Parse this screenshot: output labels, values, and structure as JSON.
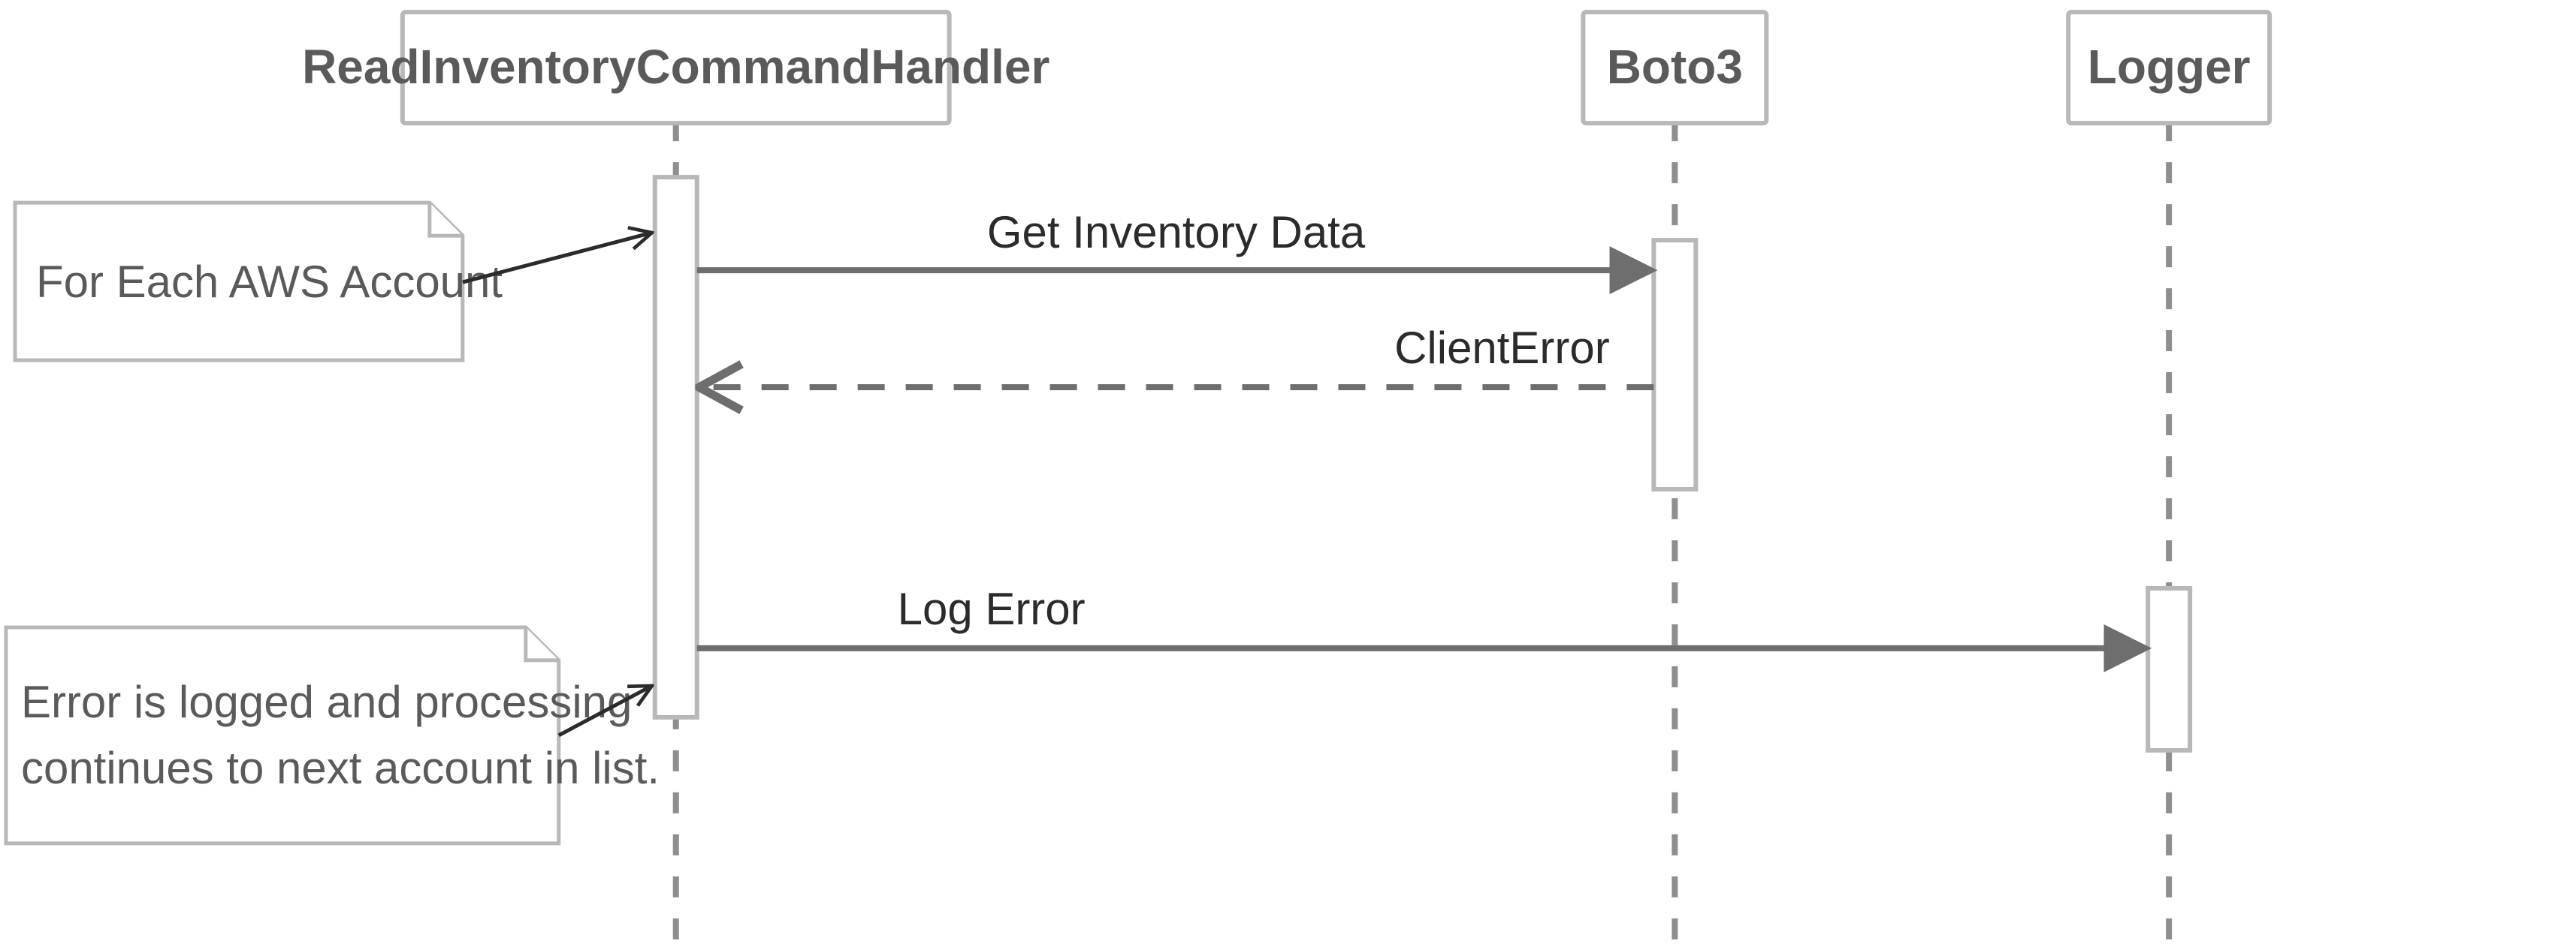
{
  "participants": {
    "handler": "ReadInventoryCommandHandler",
    "boto3": "Boto3",
    "logger": "Logger"
  },
  "messages": {
    "get_inventory": "Get Inventory Data",
    "client_error": "ClientError",
    "log_error": "Log Error"
  },
  "notes": {
    "loop": "For Each AWS Account",
    "error_line1": "Error is logged and processing",
    "error_line2": "continues to next account in list."
  }
}
